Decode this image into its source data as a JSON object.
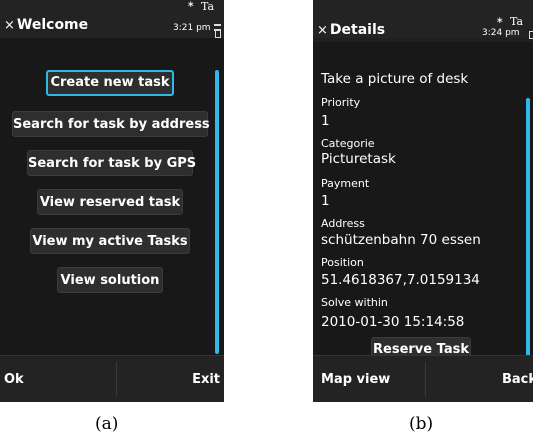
{
  "screen_a": {
    "title": "Welcome",
    "close_glyph": "×",
    "status": {
      "bluetooth": "∗",
      "signal": "Ta",
      "time": "3:21 pm"
    },
    "buttons": [
      "Create new task",
      "Search for task by address",
      "Search for task by GPS",
      "View reserved task",
      "View my active Tasks",
      "View solution"
    ],
    "softkeys": {
      "left": "Ok",
      "right": "Exit"
    }
  },
  "screen_b": {
    "title": "Details",
    "close_glyph": "×",
    "status": {
      "bluetooth": "∗",
      "signal": "Ta",
      "time": "3:24 pm"
    },
    "task_title": "Take a picture of desk",
    "fields": [
      {
        "label": "Priority",
        "value": "1"
      },
      {
        "label": "Categorie",
        "value": "Picturetask"
      },
      {
        "label": "Payment",
        "value": "1"
      },
      {
        "label": "Address",
        "value": "schützenbahn 70 essen"
      },
      {
        "label": "Position",
        "value": "51.4618367,7.0159134"
      },
      {
        "label": "Solve within",
        "value": "2010-01-30 15:14:58"
      }
    ],
    "reserve_button": "Reserve Task",
    "softkeys": {
      "left": "Map view",
      "right": "Back"
    }
  },
  "captions": {
    "a": "(a)",
    "b": "(b)"
  },
  "colors": {
    "accent": "#2fb9e7",
    "background": "#1f1f1f"
  }
}
